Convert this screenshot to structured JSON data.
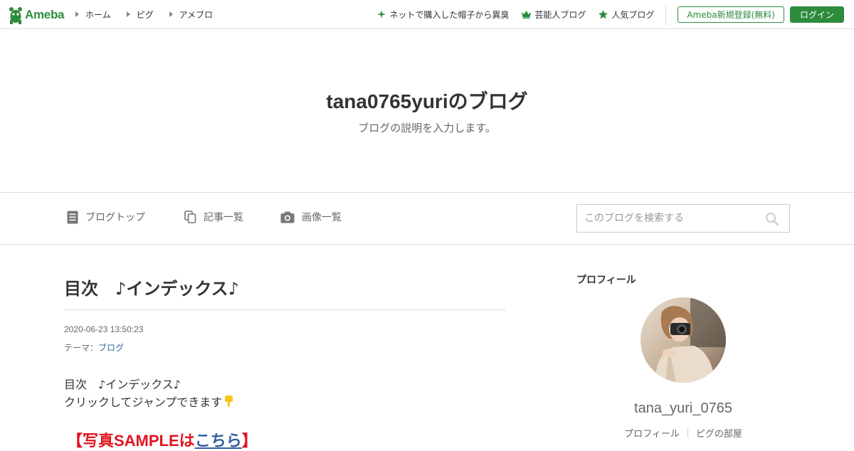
{
  "brand": {
    "name": "Ameba",
    "color": "#2d8c3c"
  },
  "topnav": {
    "items": [
      {
        "label": "ホーム"
      },
      {
        "label": "ピグ"
      },
      {
        "label": "アメブロ"
      }
    ]
  },
  "topright": {
    "promos": [
      {
        "label": "ネットで購入した帽子から異臭",
        "icon": "sparkle-icon"
      },
      {
        "label": "芸能人ブログ",
        "icon": "crown-icon"
      },
      {
        "label": "人気ブログ",
        "icon": "star-icon"
      }
    ],
    "register_label": "Ameba新規登録(無料)",
    "login_label": "ログイン"
  },
  "header": {
    "title": "tana0765yuriのブログ",
    "description": "ブログの説明を入力します。"
  },
  "blognav": {
    "items": [
      {
        "label": "ブログトップ",
        "icon": "document-icon"
      },
      {
        "label": "記事一覧",
        "icon": "copy-icon"
      },
      {
        "label": "画像一覧",
        "icon": "camera-icon"
      }
    ],
    "search_placeholder": "このブログを検索する"
  },
  "article": {
    "title": "目次　♪インデックス♪",
    "date": "2020-06-23 13:50:23",
    "theme_prefix": "テーマ：",
    "theme": "ブログ",
    "body_line1": "目次　♪インデックス♪",
    "body_line2": "クリックしてジャンプできます",
    "sample_prefix": "【写真SAMPLEは",
    "sample_link": "こちら",
    "sample_suffix": "】"
  },
  "sidebar": {
    "heading": "プロフィール",
    "profile_name": "tana_yuri_0765",
    "links": [
      {
        "label": "プロフィール"
      },
      {
        "label": "ピグの部屋"
      }
    ]
  },
  "colors": {
    "accent": "#2d8c3c",
    "link": "#3561a0",
    "sample_red": "#e0151f"
  }
}
